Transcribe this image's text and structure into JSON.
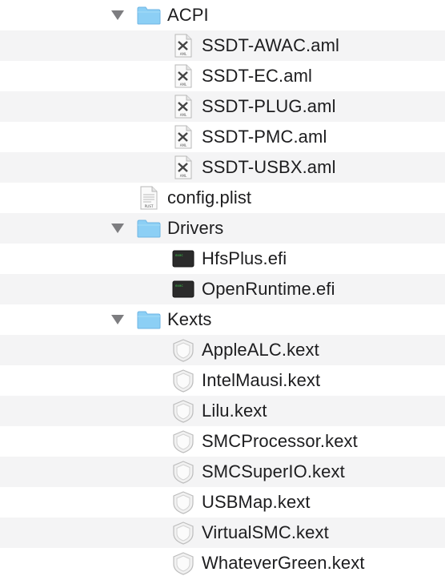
{
  "tree": [
    {
      "label": "ACPI",
      "icon": "folder-icon",
      "level": 1,
      "expanded": true
    },
    {
      "label": "SSDT-AWAC.aml",
      "icon": "aml-file-icon",
      "level": 2
    },
    {
      "label": "SSDT-EC.aml",
      "icon": "aml-file-icon",
      "level": 2
    },
    {
      "label": "SSDT-PLUG.aml",
      "icon": "aml-file-icon",
      "level": 2
    },
    {
      "label": "SSDT-PMC.aml",
      "icon": "aml-file-icon",
      "level": 2
    },
    {
      "label": "SSDT-USBX.aml",
      "icon": "aml-file-icon",
      "level": 2
    },
    {
      "label": "config.plist",
      "icon": "plist-file-icon",
      "level": 1
    },
    {
      "label": "Drivers",
      "icon": "folder-icon",
      "level": 1,
      "expanded": true
    },
    {
      "label": "HfsPlus.efi",
      "icon": "exec-file-icon",
      "level": 2
    },
    {
      "label": "OpenRuntime.efi",
      "icon": "exec-file-icon",
      "level": 2
    },
    {
      "label": "Kexts",
      "icon": "folder-icon",
      "level": 1,
      "expanded": true
    },
    {
      "label": "AppleALC.kext",
      "icon": "kext-icon",
      "level": 2
    },
    {
      "label": "IntelMausi.kext",
      "icon": "kext-icon",
      "level": 2
    },
    {
      "label": "Lilu.kext",
      "icon": "kext-icon",
      "level": 2
    },
    {
      "label": "SMCProcessor.kext",
      "icon": "kext-icon",
      "level": 2
    },
    {
      "label": "SMCSuperIO.kext",
      "icon": "kext-icon",
      "level": 2
    },
    {
      "label": "USBMap.kext",
      "icon": "kext-icon",
      "level": 2
    },
    {
      "label": "VirtualSMC.kext",
      "icon": "kext-icon",
      "level": 2
    },
    {
      "label": "WhateverGreen.kext",
      "icon": "kext-icon",
      "level": 2
    }
  ],
  "colors": {
    "folder": "#8ccff5",
    "alt_row": "#f4f4f5",
    "triangle": "#7d7d80"
  }
}
